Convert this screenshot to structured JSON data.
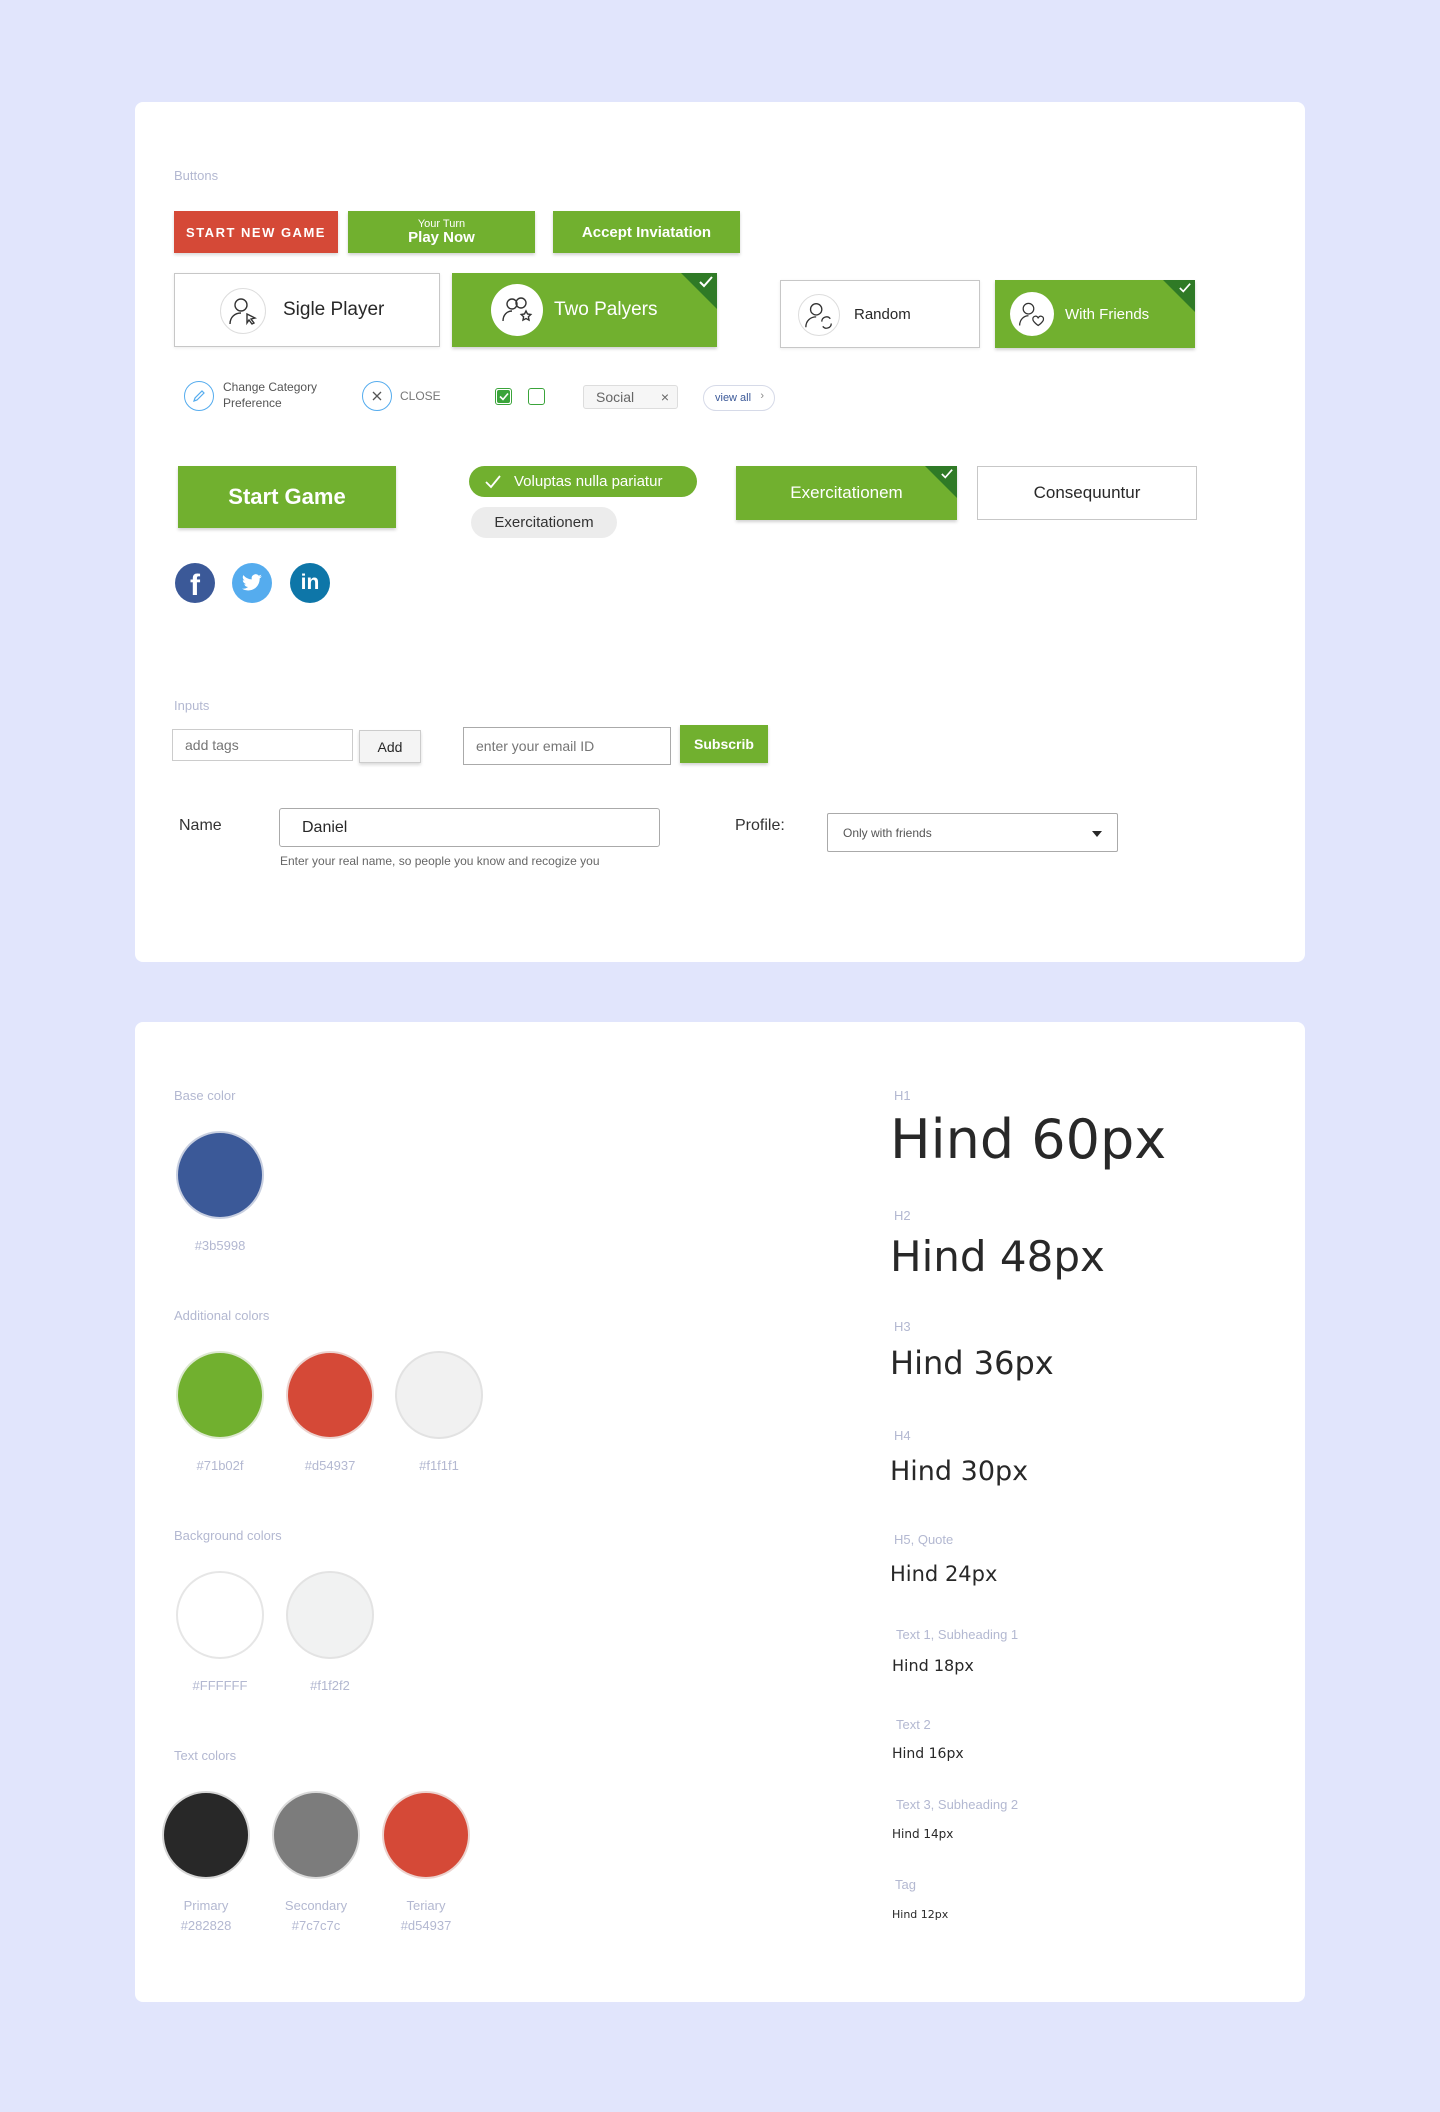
{
  "buttons_section": {
    "label": "Buttons",
    "start_new_game": "START NEW GAME",
    "your_turn_small": "Your Turn",
    "play_now": "Play Now",
    "accept_invitation": "Accept Inviatation",
    "single_player": "Sigle Player",
    "two_players": "Two Palyers",
    "random": "Random",
    "with_friends": "With Friends",
    "change_category_line1": "Change Category",
    "change_category_line2": "Preference",
    "close": "CLOSE",
    "social_tag": "Social",
    "view_all": "view all",
    "start_game": "Start Game",
    "chip_selected": "Voluptas nulla pariatur",
    "chip_unselected": "Exercitationem",
    "toggle_selected": "Exercitationem",
    "toggle_unselected": "Consequuntur"
  },
  "inputs_section": {
    "label": "Inputs",
    "tags_placeholder": "add tags",
    "add_button": "Add",
    "email_placeholder": "enter your email ID",
    "subscribe_button": "Subscrib",
    "name_label": "Name",
    "name_value": "Daniel",
    "name_hint": "Enter your real name, so people you know and recogize you",
    "profile_label": "Profile:",
    "profile_selected": "Only with friends"
  },
  "colors_section": {
    "base_label": "Base color",
    "base": [
      {
        "hex": "#3b5998",
        "label": "#3b5998"
      }
    ],
    "additional_label": "Additional colors",
    "additional": [
      {
        "hex": "#71b02f",
        "label": "#71b02f"
      },
      {
        "hex": "#d54937",
        "label": "#d54937"
      },
      {
        "hex": "#f1f1f1",
        "label": "#f1f1f1"
      }
    ],
    "background_label": "Background colors",
    "background": [
      {
        "hex": "#FFFFFF",
        "label": "#FFFFFF"
      },
      {
        "hex": "#f1f2f2",
        "label": "#f1f2f2"
      }
    ],
    "text_label": "Text colors",
    "text": [
      {
        "hex": "#282828",
        "name": "Primary",
        "label": "#282828"
      },
      {
        "hex": "#7c7c7c",
        "name": "Secondary",
        "label": "#7c7c7c"
      },
      {
        "hex": "#d54937",
        "name": "Teriary",
        "label": "#d54937"
      }
    ]
  },
  "typography_section": {
    "items": [
      {
        "label": "H1",
        "sample": "Hind 60px"
      },
      {
        "label": "H2",
        "sample": "Hind 48px"
      },
      {
        "label": "H3",
        "sample": "Hind 36px"
      },
      {
        "label": "H4",
        "sample": "Hind 30px"
      },
      {
        "label": "H5, Quote",
        "sample": "Hind 24px"
      },
      {
        "label": "Text 1, Subheading 1",
        "sample": "Hind 18px"
      },
      {
        "label": "Text 2",
        "sample": "Hind 16px"
      },
      {
        "label": "Text 3, Subheading 2",
        "sample": "Hind 14px"
      },
      {
        "label": "Tag",
        "sample": "Hind 12px"
      }
    ]
  },
  "brand_colors": {
    "green": "#71b02f",
    "red": "#d54937",
    "facebook": "#3b5998",
    "twitter": "#55acee",
    "linkedin": "#0e76a8",
    "page_bg": "#e1e5fc"
  },
  "icons": [
    "user-cursor-icon",
    "users-star-icon",
    "user-refresh-icon",
    "user-heart-icon",
    "edit-icon",
    "close-icon",
    "checkbox-icon",
    "remove-tag-icon",
    "chevron-right-icon",
    "check-icon",
    "facebook-icon",
    "twitter-icon",
    "linkedin-icon",
    "dropdown-arrow-icon"
  ]
}
